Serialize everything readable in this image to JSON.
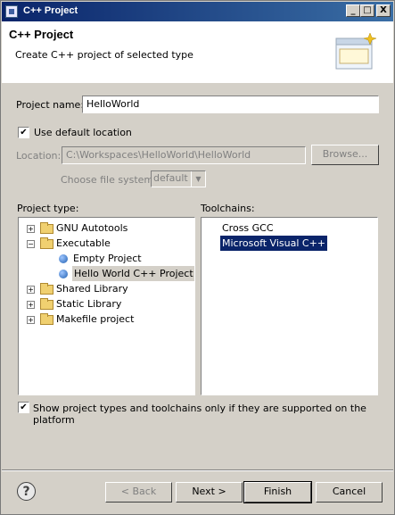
{
  "window": {
    "title": "C++ Project",
    "buttons": {
      "minimize": "_",
      "maximize": "□",
      "close": "X"
    }
  },
  "header": {
    "title": "C++ Project",
    "description": "Create C++ project of selected type"
  },
  "project_name": {
    "label": "Project name:",
    "value": "HelloWorld"
  },
  "default_location": {
    "label": "Use default location",
    "checked": true
  },
  "location": {
    "label": "Location:",
    "value": "C:\\Workspaces\\HelloWorld\\HelloWorld",
    "browse_label": "Browse..."
  },
  "filesystem": {
    "label": "Choose file system:",
    "value": "default"
  },
  "project_type": {
    "label": "Project type:",
    "items": [
      {
        "label": "GNU Autotools",
        "expanded": false
      },
      {
        "label": "Executable",
        "expanded": true
      },
      {
        "label": "Empty Project"
      },
      {
        "label": "Hello World C++ Project",
        "selected": true
      },
      {
        "label": "Shared Library",
        "expanded": false
      },
      {
        "label": "Static Library",
        "expanded": false
      },
      {
        "label": "Makefile project",
        "expanded": false
      }
    ]
  },
  "toolchains": {
    "label": "Toolchains:",
    "items": [
      "Cross GCC",
      "Microsoft Visual C++"
    ],
    "selected_index": 1
  },
  "filter": {
    "label": "Show project types and toolchains only if they are supported on the platform",
    "checked": true
  },
  "buttons": {
    "back": "< Back",
    "next": "Next >",
    "finish": "Finish",
    "cancel": "Cancel",
    "help": "?"
  }
}
